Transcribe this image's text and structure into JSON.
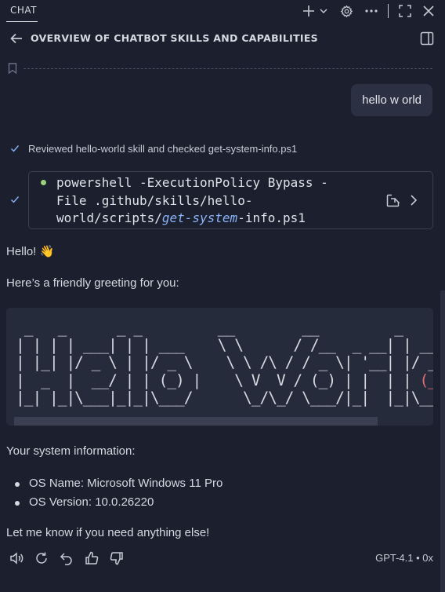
{
  "tab": {
    "label": "CHAT"
  },
  "top_icons": [
    "add-icon",
    "chevron-down-icon",
    "gear-icon",
    "more-icon",
    "maximize-icon",
    "close-icon"
  ],
  "header": {
    "title": "OVERVIEW OF CHATBOT SKILLS AND CAPABILITIES"
  },
  "user_message": "hello w orld",
  "progress": {
    "reviewed": "Reviewed hello-world skill and checked get-system-info.ps1"
  },
  "command": {
    "line1": "powershell -ExecutionPolicy Bypass -",
    "line2": "File .github/skills/hello-",
    "line3_a": "world/scripts/",
    "line3_hl": "get-system",
    "line3_b": "-info.ps1"
  },
  "response": {
    "greeting": "Hello! 👋",
    "intro": "Here’s a friendly greeting for you:",
    "ascii_art": {
      "line1": " _   _      _ _         __        __         _     _",
      "line2": "| | | | ___| | | ___    \\ \\      / /__  _ __| | __| |",
      "line3": "| |_| |/ _ \\ | |/ _ \\    \\ \\ /\\ / / _ \\| '__| |/ _`",
      "line4": "|  _  |  __/ | | (_) |    \\ V  V / (_) | |  | | ",
      "line4_red": "(_|",
      "line5": "|_| |_|\\___|_|_|\\___/      \\_/\\_/ \\___/|_|  |_|\\__,_"
    },
    "system_heading": "Your system information:",
    "system_items": [
      "OS Name: Microsoft Windows 11 Pro",
      "OS Version: 10.0.26220"
    ],
    "closing": "Let me know if you need anything else!"
  },
  "footer": {
    "model": "GPT-4.1 • 0x",
    "actions": [
      "speaker-icon",
      "retry-icon",
      "undo-icon",
      "thumbs-up-icon",
      "thumbs-down-icon"
    ]
  }
}
